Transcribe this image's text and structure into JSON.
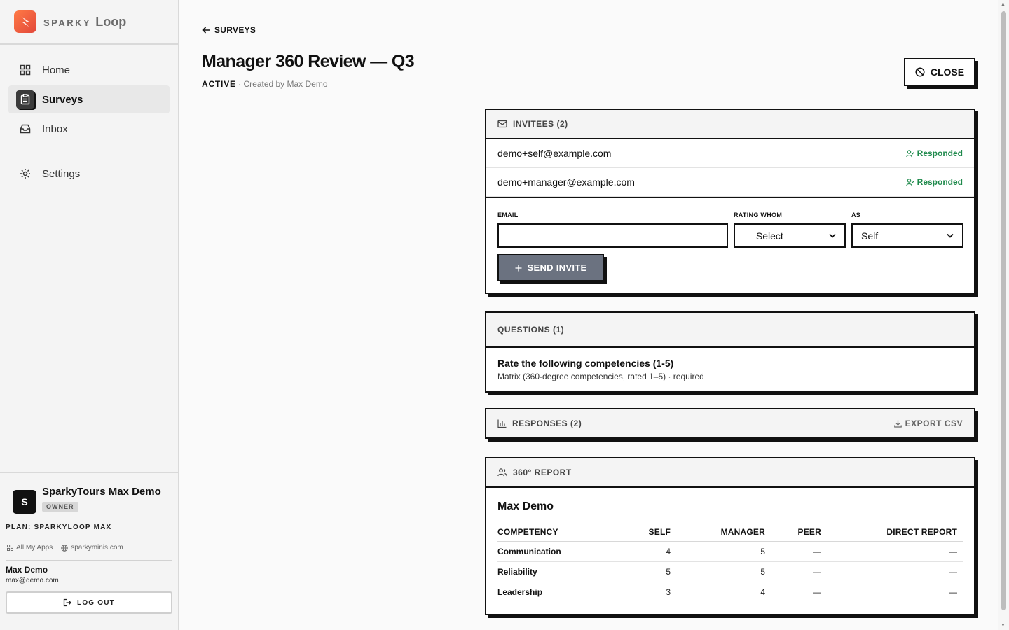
{
  "brand": {
    "sparky": "SPARKY",
    "loop": "Loop"
  },
  "nav": {
    "home": "Home",
    "surveys": "Surveys",
    "inbox": "Inbox",
    "settings": "Settings"
  },
  "account": {
    "avatar_letter": "S",
    "org_name": "SparkyTours Max Demo",
    "role_badge": "OWNER",
    "plan": "PLAN: SPARKYLOOP MAX",
    "all_apps": "All My Apps",
    "site": "sparkyminis.com",
    "user_name": "Max Demo",
    "user_email": "max@demo.com",
    "logout": "LOG OUT"
  },
  "page": {
    "back_label": "SURVEYS",
    "title": "Manager 360 Review — Q3",
    "status": "ACTIVE",
    "created_by": " · Created by Max Demo",
    "close_label": "CLOSE"
  },
  "invitees": {
    "header": "INVITEES (2)",
    "rows": [
      {
        "email": "demo+self@example.com",
        "status": "Responded"
      },
      {
        "email": "demo+manager@example.com",
        "status": "Responded"
      }
    ],
    "form": {
      "email_label": "EMAIL",
      "email_value": "",
      "rating_whom_label": "RATING WHOM",
      "rating_whom_value": "— Select —",
      "as_label": "AS",
      "as_value": "Self",
      "send_label": "SEND INVITE"
    }
  },
  "questions": {
    "header": "QUESTIONS (1)",
    "items": [
      {
        "title": "Rate the following competencies (1-5)",
        "detail": "Matrix (360-degree competencies, rated 1–5) · required"
      }
    ]
  },
  "responses": {
    "header": "RESPONSES (2)",
    "export_label": "EXPORT CSV"
  },
  "report": {
    "header": "360° REPORT",
    "person": "Max Demo",
    "columns": [
      "COMPETENCY",
      "SELF",
      "MANAGER",
      "PEER",
      "DIRECT REPORT"
    ],
    "rows": [
      [
        "Communication",
        "4",
        "5",
        "—",
        "—"
      ],
      [
        "Reliability",
        "5",
        "5",
        "—",
        "—"
      ],
      [
        "Leadership",
        "3",
        "4",
        "—",
        "—"
      ]
    ]
  },
  "colors": {
    "accent_dark": "#111111",
    "responded_green": "#1f8a4c",
    "send_button_bg": "#6b7280",
    "brand_orange": "#ff7a45"
  }
}
